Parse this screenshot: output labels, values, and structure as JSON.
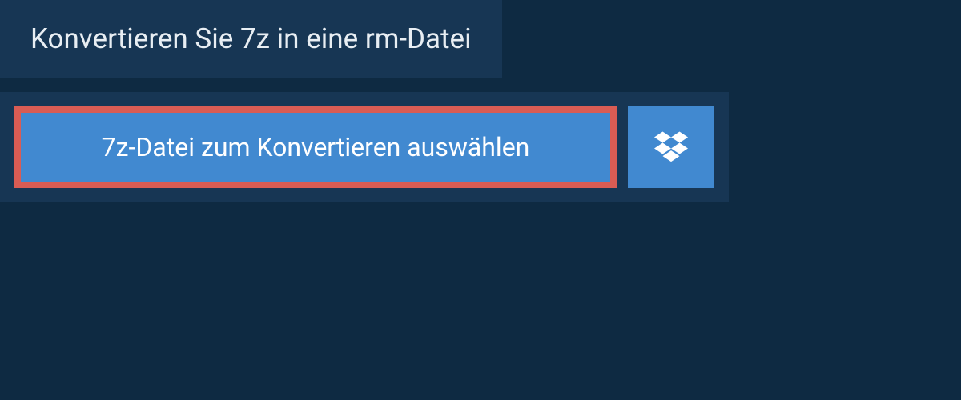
{
  "header": {
    "title": "Konvertieren Sie 7z in eine rm-Datei"
  },
  "actions": {
    "select_file_label": "7z-Datei zum Konvertieren auswählen",
    "dropbox_icon": "dropbox"
  },
  "colors": {
    "page_bg": "#0e2a42",
    "panel_bg": "#173654",
    "button_bg": "#4189d0",
    "highlight_border": "#d95c54",
    "text_light": "#e8eef3",
    "text_white": "#ffffff"
  }
}
